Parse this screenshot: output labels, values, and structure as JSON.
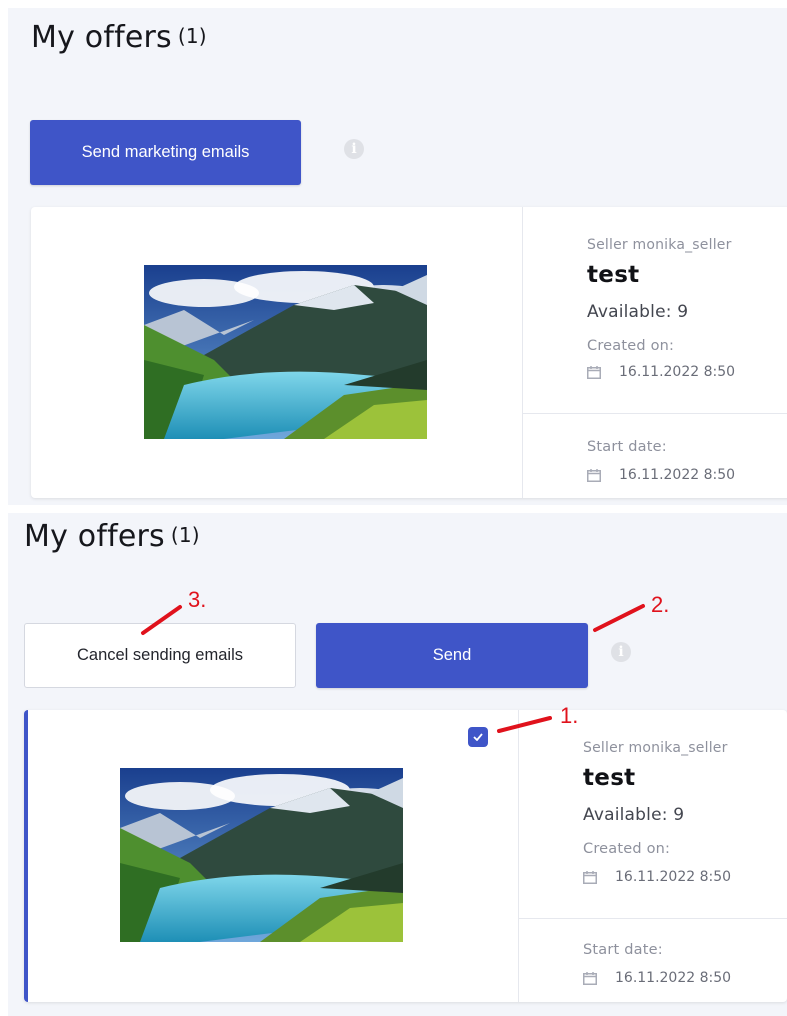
{
  "views": {
    "before": {
      "heading": "My offers",
      "count": "(1)",
      "send_marketing_label": "Send marketing emails",
      "offer": {
        "seller": "Seller monika_seller",
        "title": "test",
        "available": "Available: 9",
        "created_label": "Created on:",
        "created_date": "16.11.2022 8:50",
        "start_label": "Start date:",
        "start_date": "16.11.2022 8:50"
      }
    },
    "after": {
      "heading": "My offers",
      "count": "(1)",
      "cancel_label": "Cancel sending emails",
      "send_label": "Send",
      "offer": {
        "selected": true,
        "seller": "Seller monika_seller",
        "title": "test",
        "available": "Available: 9",
        "created_label": "Created on:",
        "created_date": "16.11.2022 8:50",
        "start_label": "Start date:",
        "start_date": "16.11.2022 8:50"
      }
    }
  },
  "annotations": {
    "step1": "1.",
    "step2": "2.",
    "step3": "3."
  },
  "icons": {
    "info": "info-icon",
    "calendar": "calendar-icon",
    "check": "checkmark-icon"
  },
  "colors": {
    "primary": "#3f55c8",
    "panel_bg": "#f3f5fa",
    "annotation": "#e0121c"
  }
}
